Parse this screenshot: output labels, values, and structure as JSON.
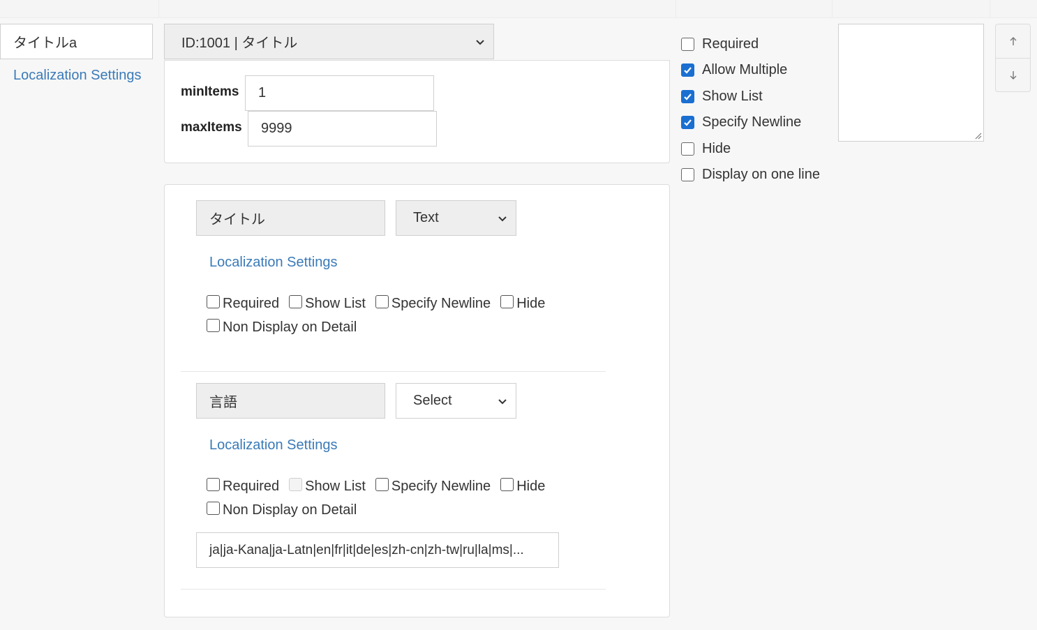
{
  "field": {
    "name_value": "タイトルa",
    "localization_link": "Localization Settings",
    "id_select": "ID:1001 | タイトル",
    "min_label": "minItems",
    "min_value": "1",
    "max_label": "maxItems",
    "max_value": "9999"
  },
  "options": {
    "required": "Required",
    "allow_multiple": "Allow Multiple",
    "show_list": "Show List",
    "specify_newline": "Specify Newline",
    "hide": "Hide",
    "display_one_line": "Display on one line"
  },
  "subitems": [
    {
      "name": "タイトル",
      "type": "Text",
      "localization_link": "Localization Settings",
      "required": "Required",
      "show_list": "Show List",
      "specify_newline": "Specify Newline",
      "hide": "Hide",
      "non_display": "Non Display on Detail"
    },
    {
      "name": "言語",
      "type": "Select",
      "localization_link": "Localization Settings",
      "required": "Required",
      "show_list": "Show List",
      "specify_newline": "Specify Newline",
      "hide": "Hide",
      "non_display": "Non Display on Detail",
      "choices": "ja|ja-Kana|ja-Latn|en|fr|it|de|es|zh-cn|zh-tw|ru|la|ms|..."
    }
  ],
  "icons": {
    "up": "arrow-up-icon",
    "down": "arrow-down-icon",
    "chevron": "chevron-down-icon"
  },
  "colors": {
    "link": "#3a7ab8",
    "checkbox_checked": "#1a6fd1"
  }
}
